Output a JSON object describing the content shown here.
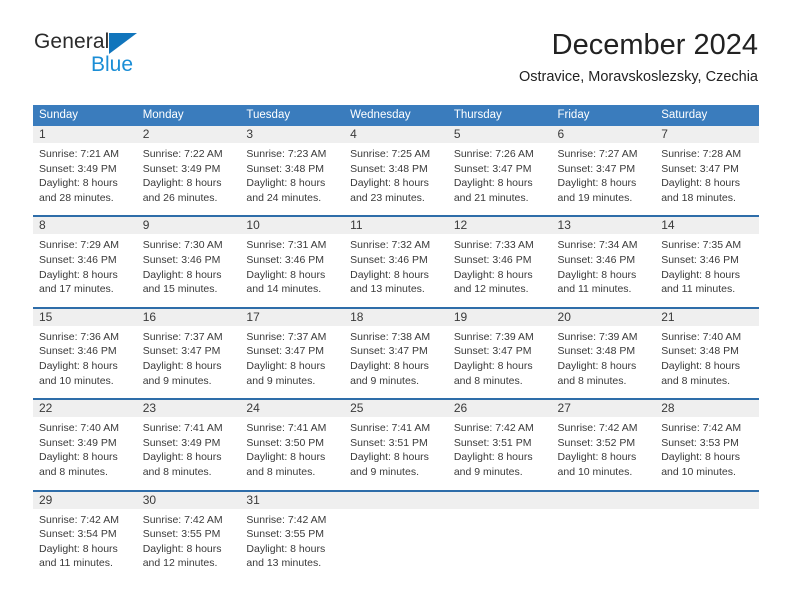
{
  "brand": {
    "name_top": "General",
    "name_bottom": "Blue",
    "accent_color": "#1175bc",
    "accent_color_light": "#1b8ed6"
  },
  "header": {
    "title": "December 2024",
    "subtitle": "Ostravice, Moravskoslezsky, Czechia"
  },
  "theme": {
    "header_bg": "#3a7cbd",
    "row_divider": "#2e6da9",
    "daynum_bg": "#efefef",
    "text": "#3a3a3a"
  },
  "weekday_headers": [
    "Sunday",
    "Monday",
    "Tuesday",
    "Wednesday",
    "Thursday",
    "Friday",
    "Saturday"
  ],
  "weeks": [
    [
      {
        "day": "1",
        "sunrise": "Sunrise: 7:21 AM",
        "sunset": "Sunset: 3:49 PM",
        "daylight1": "Daylight: 8 hours",
        "daylight2": "and 28 minutes."
      },
      {
        "day": "2",
        "sunrise": "Sunrise: 7:22 AM",
        "sunset": "Sunset: 3:49 PM",
        "daylight1": "Daylight: 8 hours",
        "daylight2": "and 26 minutes."
      },
      {
        "day": "3",
        "sunrise": "Sunrise: 7:23 AM",
        "sunset": "Sunset: 3:48 PM",
        "daylight1": "Daylight: 8 hours",
        "daylight2": "and 24 minutes."
      },
      {
        "day": "4",
        "sunrise": "Sunrise: 7:25 AM",
        "sunset": "Sunset: 3:48 PM",
        "daylight1": "Daylight: 8 hours",
        "daylight2": "and 23 minutes."
      },
      {
        "day": "5",
        "sunrise": "Sunrise: 7:26 AM",
        "sunset": "Sunset: 3:47 PM",
        "daylight1": "Daylight: 8 hours",
        "daylight2": "and 21 minutes."
      },
      {
        "day": "6",
        "sunrise": "Sunrise: 7:27 AM",
        "sunset": "Sunset: 3:47 PM",
        "daylight1": "Daylight: 8 hours",
        "daylight2": "and 19 minutes."
      },
      {
        "day": "7",
        "sunrise": "Sunrise: 7:28 AM",
        "sunset": "Sunset: 3:47 PM",
        "daylight1": "Daylight: 8 hours",
        "daylight2": "and 18 minutes."
      }
    ],
    [
      {
        "day": "8",
        "sunrise": "Sunrise: 7:29 AM",
        "sunset": "Sunset: 3:46 PM",
        "daylight1": "Daylight: 8 hours",
        "daylight2": "and 17 minutes."
      },
      {
        "day": "9",
        "sunrise": "Sunrise: 7:30 AM",
        "sunset": "Sunset: 3:46 PM",
        "daylight1": "Daylight: 8 hours",
        "daylight2": "and 15 minutes."
      },
      {
        "day": "10",
        "sunrise": "Sunrise: 7:31 AM",
        "sunset": "Sunset: 3:46 PM",
        "daylight1": "Daylight: 8 hours",
        "daylight2": "and 14 minutes."
      },
      {
        "day": "11",
        "sunrise": "Sunrise: 7:32 AM",
        "sunset": "Sunset: 3:46 PM",
        "daylight1": "Daylight: 8 hours",
        "daylight2": "and 13 minutes."
      },
      {
        "day": "12",
        "sunrise": "Sunrise: 7:33 AM",
        "sunset": "Sunset: 3:46 PM",
        "daylight1": "Daylight: 8 hours",
        "daylight2": "and 12 minutes."
      },
      {
        "day": "13",
        "sunrise": "Sunrise: 7:34 AM",
        "sunset": "Sunset: 3:46 PM",
        "daylight1": "Daylight: 8 hours",
        "daylight2": "and 11 minutes."
      },
      {
        "day": "14",
        "sunrise": "Sunrise: 7:35 AM",
        "sunset": "Sunset: 3:46 PM",
        "daylight1": "Daylight: 8 hours",
        "daylight2": "and 11 minutes."
      }
    ],
    [
      {
        "day": "15",
        "sunrise": "Sunrise: 7:36 AM",
        "sunset": "Sunset: 3:46 PM",
        "daylight1": "Daylight: 8 hours",
        "daylight2": "and 10 minutes."
      },
      {
        "day": "16",
        "sunrise": "Sunrise: 7:37 AM",
        "sunset": "Sunset: 3:47 PM",
        "daylight1": "Daylight: 8 hours",
        "daylight2": "and 9 minutes."
      },
      {
        "day": "17",
        "sunrise": "Sunrise: 7:37 AM",
        "sunset": "Sunset: 3:47 PM",
        "daylight1": "Daylight: 8 hours",
        "daylight2": "and 9 minutes."
      },
      {
        "day": "18",
        "sunrise": "Sunrise: 7:38 AM",
        "sunset": "Sunset: 3:47 PM",
        "daylight1": "Daylight: 8 hours",
        "daylight2": "and 9 minutes."
      },
      {
        "day": "19",
        "sunrise": "Sunrise: 7:39 AM",
        "sunset": "Sunset: 3:47 PM",
        "daylight1": "Daylight: 8 hours",
        "daylight2": "and 8 minutes."
      },
      {
        "day": "20",
        "sunrise": "Sunrise: 7:39 AM",
        "sunset": "Sunset: 3:48 PM",
        "daylight1": "Daylight: 8 hours",
        "daylight2": "and 8 minutes."
      },
      {
        "day": "21",
        "sunrise": "Sunrise: 7:40 AM",
        "sunset": "Sunset: 3:48 PM",
        "daylight1": "Daylight: 8 hours",
        "daylight2": "and 8 minutes."
      }
    ],
    [
      {
        "day": "22",
        "sunrise": "Sunrise: 7:40 AM",
        "sunset": "Sunset: 3:49 PM",
        "daylight1": "Daylight: 8 hours",
        "daylight2": "and 8 minutes."
      },
      {
        "day": "23",
        "sunrise": "Sunrise: 7:41 AM",
        "sunset": "Sunset: 3:49 PM",
        "daylight1": "Daylight: 8 hours",
        "daylight2": "and 8 minutes."
      },
      {
        "day": "24",
        "sunrise": "Sunrise: 7:41 AM",
        "sunset": "Sunset: 3:50 PM",
        "daylight1": "Daylight: 8 hours",
        "daylight2": "and 8 minutes."
      },
      {
        "day": "25",
        "sunrise": "Sunrise: 7:41 AM",
        "sunset": "Sunset: 3:51 PM",
        "daylight1": "Daylight: 8 hours",
        "daylight2": "and 9 minutes."
      },
      {
        "day": "26",
        "sunrise": "Sunrise: 7:42 AM",
        "sunset": "Sunset: 3:51 PM",
        "daylight1": "Daylight: 8 hours",
        "daylight2": "and 9 minutes."
      },
      {
        "day": "27",
        "sunrise": "Sunrise: 7:42 AM",
        "sunset": "Sunset: 3:52 PM",
        "daylight1": "Daylight: 8 hours",
        "daylight2": "and 10 minutes."
      },
      {
        "day": "28",
        "sunrise": "Sunrise: 7:42 AM",
        "sunset": "Sunset: 3:53 PM",
        "daylight1": "Daylight: 8 hours",
        "daylight2": "and 10 minutes."
      }
    ],
    [
      {
        "day": "29",
        "sunrise": "Sunrise: 7:42 AM",
        "sunset": "Sunset: 3:54 PM",
        "daylight1": "Daylight: 8 hours",
        "daylight2": "and 11 minutes."
      },
      {
        "day": "30",
        "sunrise": "Sunrise: 7:42 AM",
        "sunset": "Sunset: 3:55 PM",
        "daylight1": "Daylight: 8 hours",
        "daylight2": "and 12 minutes."
      },
      {
        "day": "31",
        "sunrise": "Sunrise: 7:42 AM",
        "sunset": "Sunset: 3:55 PM",
        "daylight1": "Daylight: 8 hours",
        "daylight2": "and 13 minutes."
      },
      {
        "day": "",
        "sunrise": "",
        "sunset": "",
        "daylight1": "",
        "daylight2": ""
      },
      {
        "day": "",
        "sunrise": "",
        "sunset": "",
        "daylight1": "",
        "daylight2": ""
      },
      {
        "day": "",
        "sunrise": "",
        "sunset": "",
        "daylight1": "",
        "daylight2": ""
      },
      {
        "day": "",
        "sunrise": "",
        "sunset": "",
        "daylight1": "",
        "daylight2": ""
      }
    ]
  ]
}
